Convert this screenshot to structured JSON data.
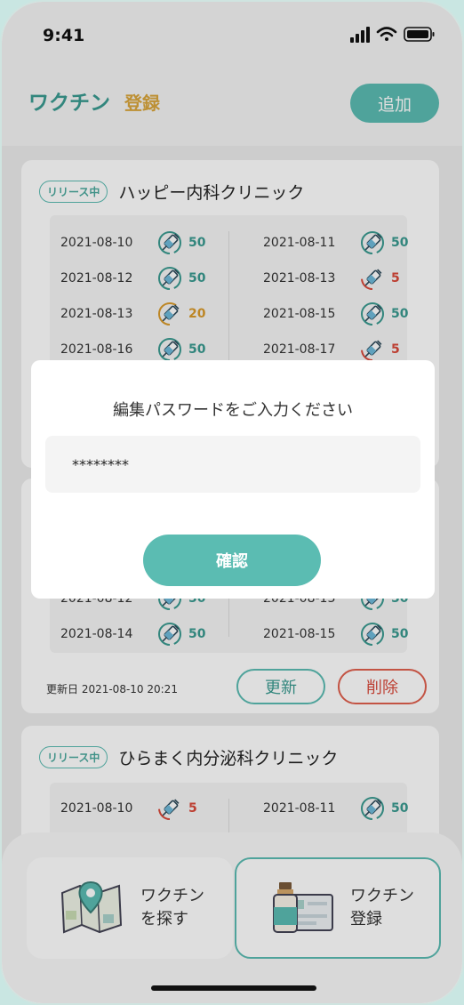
{
  "status_bar": {
    "time": "9:41"
  },
  "header": {
    "title_main": "ワクチン",
    "title_sub": "登録",
    "add_button": "追加"
  },
  "colors": {
    "accent": "#5bbcb2",
    "accent_dark": "#3a9a90",
    "warning": "#d9a63c",
    "danger": "#d9493a"
  },
  "cards": [
    {
      "badge": "リリース中",
      "clinic": "ハッピー内科クリニック",
      "doses": [
        {
          "date": "2021-08-10",
          "count": "50",
          "level": "high"
        },
        {
          "date": "2021-08-11",
          "count": "50",
          "level": "high"
        },
        {
          "date": "2021-08-12",
          "count": "50",
          "level": "high"
        },
        {
          "date": "2021-08-13",
          "count": "5",
          "level": "low"
        },
        {
          "date": "2021-08-13",
          "count": "20",
          "level": "mid"
        },
        {
          "date": "2021-08-15",
          "count": "50",
          "level": "high"
        },
        {
          "date": "2021-08-16",
          "count": "50",
          "level": "high"
        },
        {
          "date": "2021-08-17",
          "count": "5",
          "level": "low"
        }
      ]
    },
    {
      "doses": [
        {
          "date": "2021-08-12",
          "count": "50",
          "level": "high"
        },
        {
          "date": "2021-08-13",
          "count": "50",
          "level": "high"
        },
        {
          "date": "2021-08-14",
          "count": "50",
          "level": "high"
        },
        {
          "date": "2021-08-15",
          "count": "50",
          "level": "high"
        }
      ],
      "updated": "更新日 2021-08-10 20:21",
      "renew_button": "更新",
      "delete_button": "削除"
    },
    {
      "badge": "リリース中",
      "clinic": "ひらまく内分泌科クリニック",
      "doses": [
        {
          "date": "2021-08-10",
          "count": "5",
          "level": "low"
        },
        {
          "date": "2021-08-11",
          "count": "50",
          "level": "high"
        }
      ]
    }
  ],
  "bottom_nav": [
    {
      "label": "ワクチン\nを探す",
      "icon": "map-icon"
    },
    {
      "label": "ワクチン\n登録",
      "icon": "vaccine-card-icon"
    }
  ],
  "modal": {
    "title": "編集パスワードをご入力ください",
    "password_value": "********",
    "confirm_button": "確認"
  }
}
